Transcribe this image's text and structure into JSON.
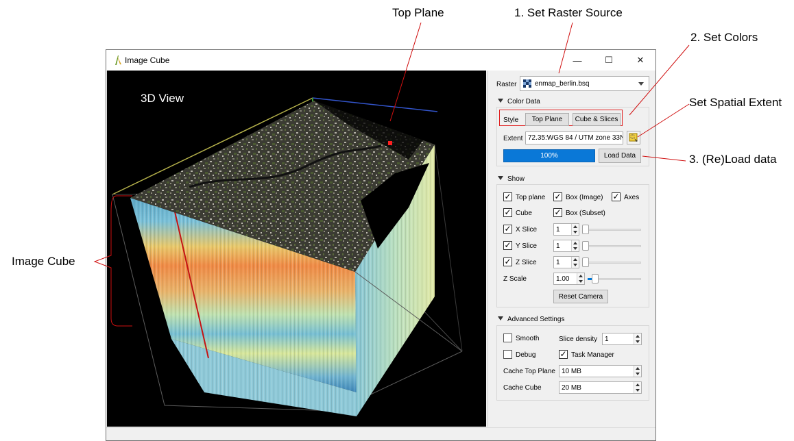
{
  "annotations": {
    "top_plane": "Top Plane",
    "set_raster_source": "1. Set Raster Source",
    "set_colors": "2. Set Colors",
    "set_spatial_extent": "Set Spatial Extent",
    "reload_data": "3. (Re)Load data",
    "image_cube": "Image Cube"
  },
  "window": {
    "title": "Image Cube",
    "minimize": "—",
    "maximize": "☐",
    "close": "✕"
  },
  "view": {
    "label": "3D View"
  },
  "panel": {
    "raster_label": "Raster",
    "raster_value": "enmap_berlin.bsq",
    "color_data": {
      "header": "Color Data",
      "style_label": "Style",
      "top_plane_button": "Top Plane",
      "cube_slices_button": "Cube & Slices",
      "extent_label": "Extent",
      "extent_value": "72.35:WGS 84 / UTM zone 33N",
      "progress_text": "100%",
      "progress_value": 1.0,
      "load_button": "Load Data"
    },
    "show": {
      "header": "Show",
      "top_plane": "Top plane",
      "box_image": "Box (Image)",
      "axes": "Axes",
      "cube": "Cube",
      "box_subset": "Box (Subset)",
      "x_slice": "X Slice",
      "x_value": "1",
      "y_slice": "Y Slice",
      "y_value": "1",
      "z_slice": "Z Slice",
      "z_value": "1",
      "z_scale": "Z Scale",
      "z_scale_value": "1.00",
      "reset_camera": "Reset Camera"
    },
    "advanced": {
      "header": "Advanced Settings",
      "smooth": "Smooth",
      "slice_density_label": "Slice density",
      "slice_density_value": "1",
      "debug": "Debug",
      "task_manager": "Task Manager",
      "cache_top_label": "Cache Top Plane",
      "cache_top_value": "10 MB",
      "cache_cube_label": "Cache Cube",
      "cache_cube_value": "20 MB"
    }
  },
  "colors": {
    "accent": "#0078d7",
    "highlight": "#e02020"
  }
}
